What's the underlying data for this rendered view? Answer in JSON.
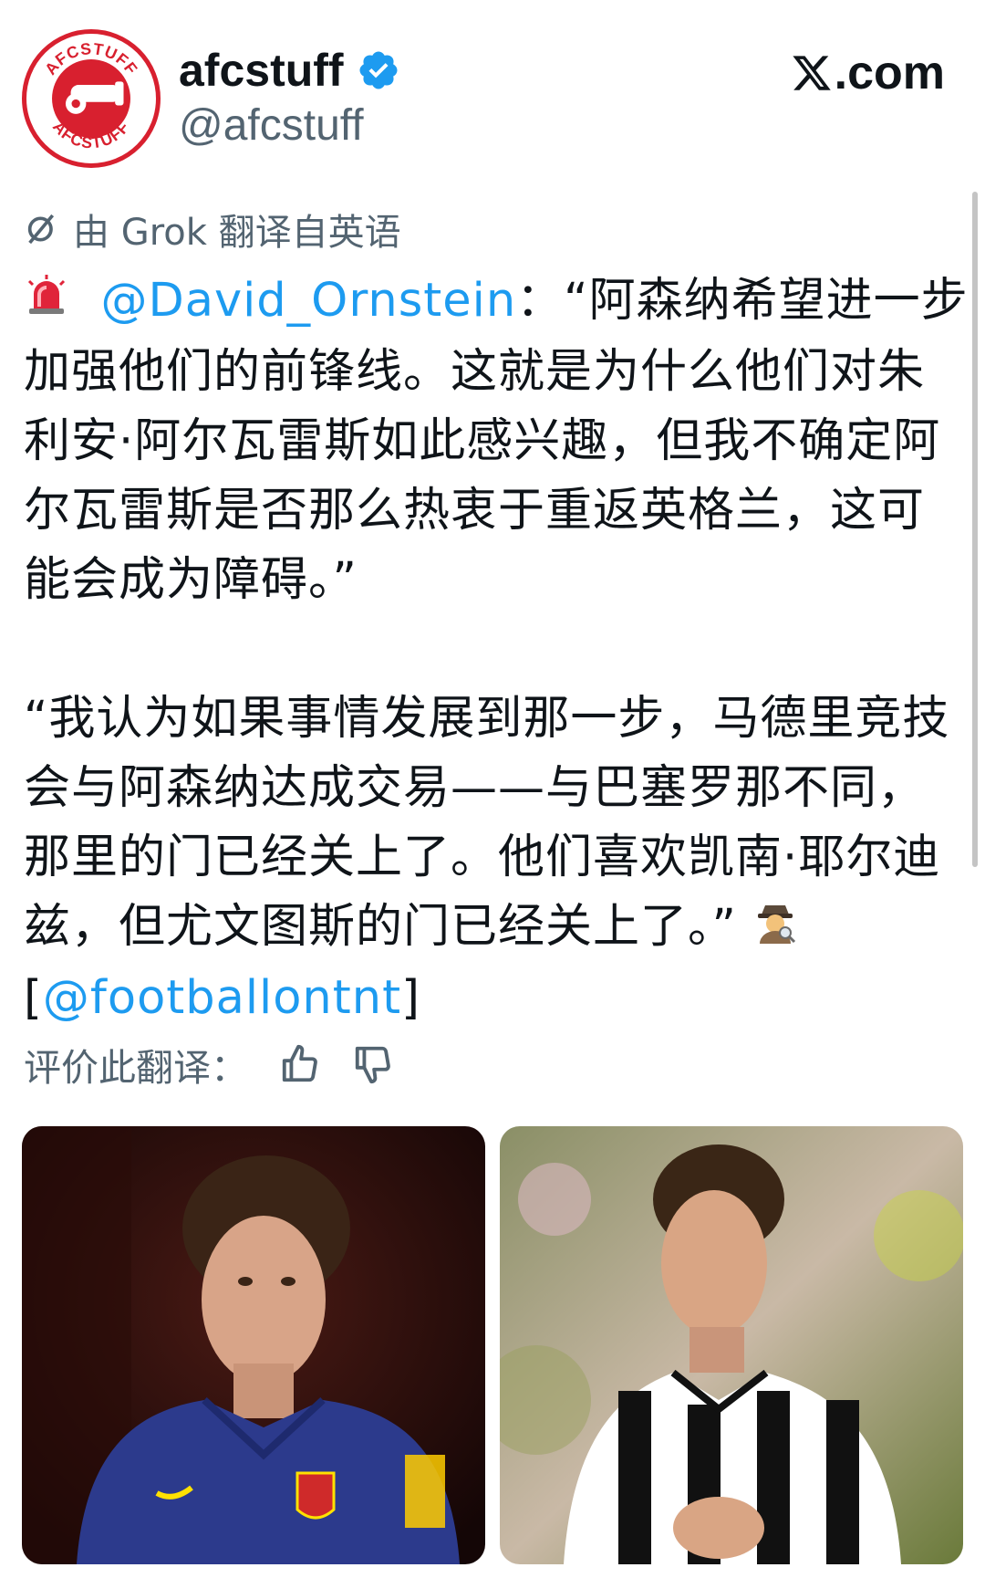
{
  "profile": {
    "display_name": "afcstuff",
    "handle": "@afcstuff",
    "avatar_text_top": "AFCSTUFF",
    "avatar_text_bottom": "AFCSTUFF",
    "verified": true
  },
  "site": {
    "label": ".com",
    "logo_icon": "x-logo-icon"
  },
  "translation_note": "由 Grok 翻译自英语",
  "post": {
    "para1_mention": "@David_Ornstein",
    "para1_text": "：“阿森纳希望进一步加强他们的前锋线。这就是为什么他们对朱利安·阿尔瓦雷斯如此感兴趣，但我不确定阿尔瓦雷斯是否那么热衷于重返英格兰，这可能会成为障碍。”",
    "para2_text": "“我认为如果事情发展到那一步，马德里竞技会与阿森纳达成交易——与巴塞罗那不同，那里的门已经关上了。他们喜欢凯南·耶尔迪兹，但尤文图斯的门已经关上了。”",
    "source_open": "[",
    "source_mention": "@footballontnt",
    "source_close": "]"
  },
  "rate_label": "评价此翻译：",
  "images": [
    {
      "alt": "player-atletico",
      "jersey_color": "#2c3a8c"
    },
    {
      "alt": "player-juventus",
      "jersey_color": "#111111"
    }
  ],
  "colors": {
    "link": "#1d9bf0",
    "brand_red": "#d8202f",
    "verified": "#1d9bf0",
    "muted": "#536471"
  }
}
